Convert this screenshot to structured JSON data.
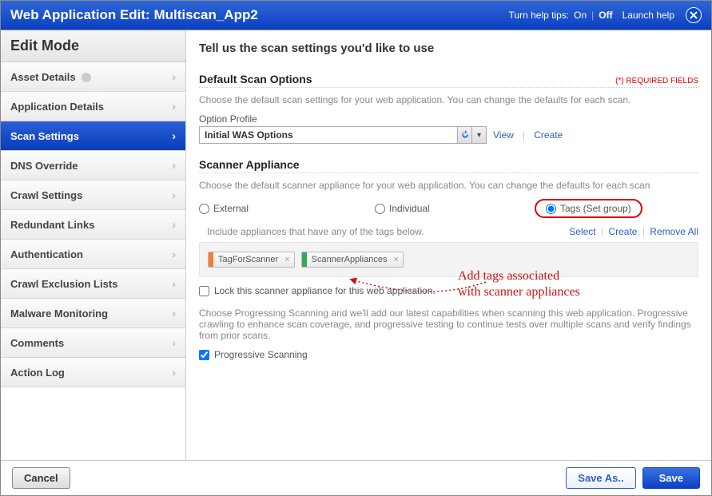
{
  "titlebar": {
    "title": "Web Application Edit: Multiscan_App2",
    "help_tips_label": "Turn help tips:",
    "on": "On",
    "off": "Off",
    "launch_help": "Launch help"
  },
  "sidebar": {
    "heading": "Edit Mode",
    "items": [
      {
        "label": "Asset Details",
        "active": false,
        "has_globe": true
      },
      {
        "label": "Application Details",
        "active": false
      },
      {
        "label": "Scan Settings",
        "active": true
      },
      {
        "label": "DNS Override",
        "active": false
      },
      {
        "label": "Crawl Settings",
        "active": false
      },
      {
        "label": "Redundant Links",
        "active": false
      },
      {
        "label": "Authentication",
        "active": false
      },
      {
        "label": "Crawl Exclusion Lists",
        "active": false
      },
      {
        "label": "Malware Monitoring",
        "active": false
      },
      {
        "label": "Comments",
        "active": false
      },
      {
        "label": "Action Log",
        "active": false
      }
    ]
  },
  "main": {
    "heading": "Tell us the scan settings you'd like to use",
    "required_note": "(*) REQUIRED FIELDS",
    "default_scan": {
      "title": "Default Scan Options",
      "help": "Choose the default scan settings for your web application. You can change the defaults for each scan.",
      "option_profile_label": "Option Profile",
      "option_profile_value": "Initial WAS Options",
      "view": "View",
      "create": "Create"
    },
    "scanner_appliance": {
      "title": "Scanner Appliance",
      "help": "Choose the default scanner appliance for your web application. You can change the defaults for each scan",
      "radios": {
        "external": "External",
        "individual": "Individual",
        "tags": "Tags (Set group)"
      },
      "tag_include_label": "Include appliances that have any of the tags below.",
      "select": "Select",
      "create": "Create",
      "remove_all": "Remove All",
      "tags": [
        {
          "label": "TagForScanner",
          "color": "#f08030"
        },
        {
          "label": "ScannerAppliances",
          "color": "#34a853"
        }
      ],
      "lock_label": "Lock this scanner appliance for this web application."
    },
    "progressive": {
      "help": "Choose Progressing Scanning and we'll add our latest capabilities when scanning this web application. Progressive crawling to enhance scan coverage, and progressive testing to continue tests over multiple scans and verify findings from prior scans.",
      "label": "Progressive Scanning"
    },
    "annotation": {
      "line1": "Add tags associated",
      "line2": "with scanner appliances"
    }
  },
  "footer": {
    "cancel": "Cancel",
    "save_as": "Save As..",
    "save": "Save"
  }
}
